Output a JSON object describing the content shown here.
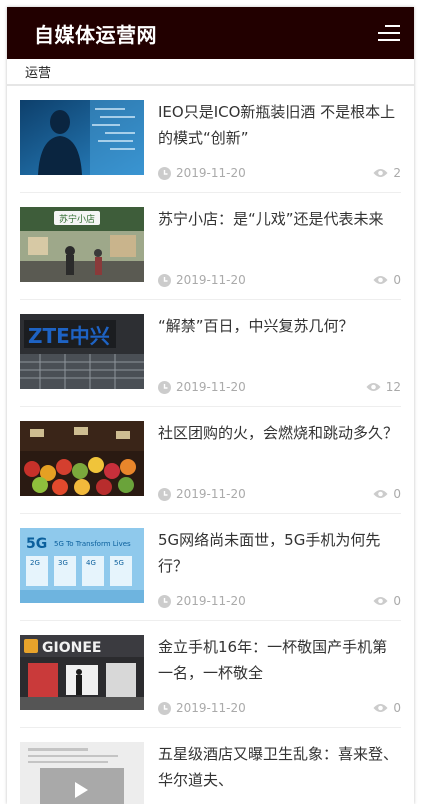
{
  "header": {
    "site_title": "自媒体运营网",
    "menu_icon": "hamburger-menu-icon"
  },
  "section": {
    "label": "运营"
  },
  "articles": [
    {
      "title": "IEO只是ICO新瓶装旧酒 不是根本上的模式“创新”",
      "date": "2019-11-20",
      "views": "2",
      "thumb_text": ""
    },
    {
      "title": "苏宁小店：是“儿戏”还是代表未来",
      "date": "2019-11-20",
      "views": "0",
      "thumb_text": "苏宁小店"
    },
    {
      "title": "“解禁”百日，中兴复苏几何？",
      "date": "2019-11-20",
      "views": "12",
      "thumb_text": "ZTE中兴"
    },
    {
      "title": "社区团购的火，会燃烧和跳动多久？",
      "date": "2019-11-20",
      "views": "0",
      "thumb_text": ""
    },
    {
      "title": "5G网络尚未面世，5G手机为何先行？",
      "date": "2019-11-20",
      "views": "0",
      "thumb_text": "5G To Transform Lives"
    },
    {
      "title": "金立手机16年：一杯敬国产手机第一名，一杯敬全",
      "date": "2019-11-20",
      "views": "0",
      "thumb_text": "GIONEE"
    },
    {
      "title": "五星级酒店又曝卫生乱象：喜来登、华尔道夫、",
      "date": "",
      "views": "",
      "thumb_text": ""
    }
  ],
  "colors": {
    "header_bg": "#220000",
    "meta_text": "#aaaaaa",
    "title_text": "#333333"
  }
}
